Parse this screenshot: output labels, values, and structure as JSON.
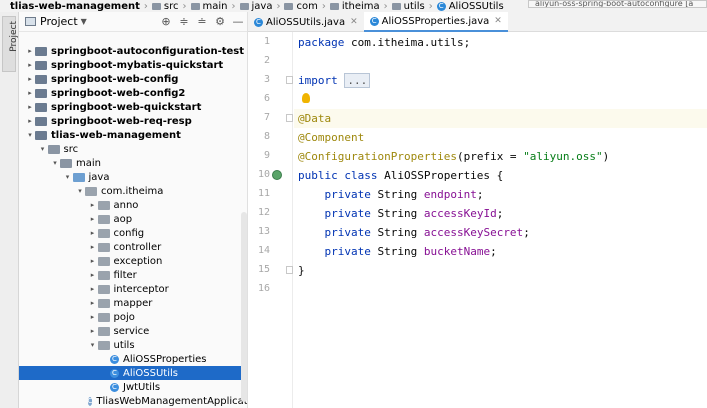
{
  "breadcrumb": [
    "tlias-web-management",
    "src",
    "main",
    "java",
    "com",
    "itheima",
    "utils",
    "AliOSSUtils"
  ],
  "hint_text": "aliyun-oss-spring-boot-autoconfigure [a",
  "tool_strip": {
    "project_tab": "Project"
  },
  "project_panel": {
    "title": "Project"
  },
  "tree": [
    {
      "label": "springboot-autoconfiguration-test",
      "depth": 0,
      "kind": "module",
      "expanded": false,
      "bold": true
    },
    {
      "label": "springboot-mybatis-quickstart",
      "depth": 0,
      "kind": "module",
      "expanded": false,
      "bold": true
    },
    {
      "label": "springboot-web-config",
      "depth": 0,
      "kind": "module",
      "expanded": false,
      "bold": true
    },
    {
      "label": "springboot-web-config2",
      "depth": 0,
      "kind": "module",
      "expanded": false,
      "bold": true
    },
    {
      "label": "springboot-web-quickstart",
      "depth": 0,
      "kind": "module",
      "expanded": false,
      "bold": true
    },
    {
      "label": "springboot-web-req-resp",
      "depth": 0,
      "kind": "module",
      "expanded": false,
      "bold": true
    },
    {
      "label": "tlias-web-management",
      "depth": 0,
      "kind": "module",
      "expanded": true,
      "bold": true
    },
    {
      "label": "src",
      "depth": 1,
      "kind": "folder",
      "expanded": true
    },
    {
      "label": "main",
      "depth": 2,
      "kind": "folder",
      "expanded": true
    },
    {
      "label": "java",
      "depth": 3,
      "kind": "src",
      "expanded": true
    },
    {
      "label": "com.itheima",
      "depth": 4,
      "kind": "package",
      "expanded": true
    },
    {
      "label": "anno",
      "depth": 5,
      "kind": "package",
      "expanded": false
    },
    {
      "label": "aop",
      "depth": 5,
      "kind": "package",
      "expanded": false
    },
    {
      "label": "config",
      "depth": 5,
      "kind": "package",
      "expanded": false
    },
    {
      "label": "controller",
      "depth": 5,
      "kind": "package",
      "expanded": false
    },
    {
      "label": "exception",
      "depth": 5,
      "kind": "package",
      "expanded": false
    },
    {
      "label": "filter",
      "depth": 5,
      "kind": "package",
      "expanded": false
    },
    {
      "label": "interceptor",
      "depth": 5,
      "kind": "package",
      "expanded": false
    },
    {
      "label": "mapper",
      "depth": 5,
      "kind": "package",
      "expanded": false
    },
    {
      "label": "pojo",
      "depth": 5,
      "kind": "package",
      "expanded": false
    },
    {
      "label": "service",
      "depth": 5,
      "kind": "package",
      "expanded": false
    },
    {
      "label": "utils",
      "depth": 5,
      "kind": "package",
      "expanded": true
    },
    {
      "label": "AliOSSProperties",
      "depth": 6,
      "kind": "class"
    },
    {
      "label": "AliOSSUtils",
      "depth": 6,
      "kind": "class",
      "selected": true
    },
    {
      "label": "JwtUtils",
      "depth": 6,
      "kind": "class"
    },
    {
      "label": "TliasWebManagementApplication",
      "depth": 5,
      "kind": "app"
    }
  ],
  "tabs": [
    {
      "label": "AliOSSUtils.java",
      "active": false
    },
    {
      "label": "AliOSSProperties.java",
      "active": true
    }
  ],
  "editor": {
    "current_line": 7,
    "lines": [
      {
        "n": "1",
        "tokens": [
          [
            "kw",
            "package "
          ],
          [
            "plain",
            "com.itheima.utils;"
          ]
        ]
      },
      {
        "n": "2",
        "tokens": []
      },
      {
        "n": "3",
        "tokens": [
          [
            "kw",
            "import "
          ],
          [
            "fold",
            "..."
          ]
        ]
      },
      {
        "n": "6",
        "tokens": []
      },
      {
        "n": "7",
        "tokens": [
          [
            "an",
            "@Data"
          ]
        ]
      },
      {
        "n": "8",
        "tokens": [
          [
            "an",
            "@Component"
          ]
        ]
      },
      {
        "n": "9",
        "tokens": [
          [
            "an",
            "@ConfigurationProperties"
          ],
          [
            "plain",
            "(prefix = "
          ],
          [
            "str",
            "\"aliyun.oss\""
          ],
          [
            "plain",
            ")"
          ]
        ]
      },
      {
        "n": "10",
        "tokens": [
          [
            "kw",
            "public class "
          ],
          [
            "plain",
            "AliOSSProperties {"
          ]
        ]
      },
      {
        "n": "11",
        "tokens": [
          [
            "plain",
            "    "
          ],
          [
            "kw",
            "private "
          ],
          [
            "plain",
            "String "
          ],
          [
            "fld",
            "endpoint"
          ],
          [
            "plain",
            ";"
          ]
        ]
      },
      {
        "n": "12",
        "tokens": [
          [
            "plain",
            "    "
          ],
          [
            "kw",
            "private "
          ],
          [
            "plain",
            "String "
          ],
          [
            "fld",
            "accessKeyId"
          ],
          [
            "plain",
            ";"
          ]
        ]
      },
      {
        "n": "13",
        "tokens": [
          [
            "plain",
            "    "
          ],
          [
            "kw",
            "private "
          ],
          [
            "plain",
            "String "
          ],
          [
            "fld",
            "accessKeySecret"
          ],
          [
            "plain",
            ";"
          ]
        ]
      },
      {
        "n": "14",
        "tokens": [
          [
            "plain",
            "    "
          ],
          [
            "kw",
            "private "
          ],
          [
            "plain",
            "String "
          ],
          [
            "fld",
            "bucketName"
          ],
          [
            "plain",
            ";"
          ]
        ]
      },
      {
        "n": "15",
        "tokens": [
          [
            "plain",
            "}"
          ]
        ]
      },
      {
        "n": "16",
        "tokens": []
      }
    ]
  },
  "colors": {
    "keyword": "#0033b3",
    "annotation": "#9e880d",
    "string": "#067d17",
    "field": "#871094",
    "selection": "#1e6ac8",
    "active_tab_underline": "#4a90d9"
  }
}
